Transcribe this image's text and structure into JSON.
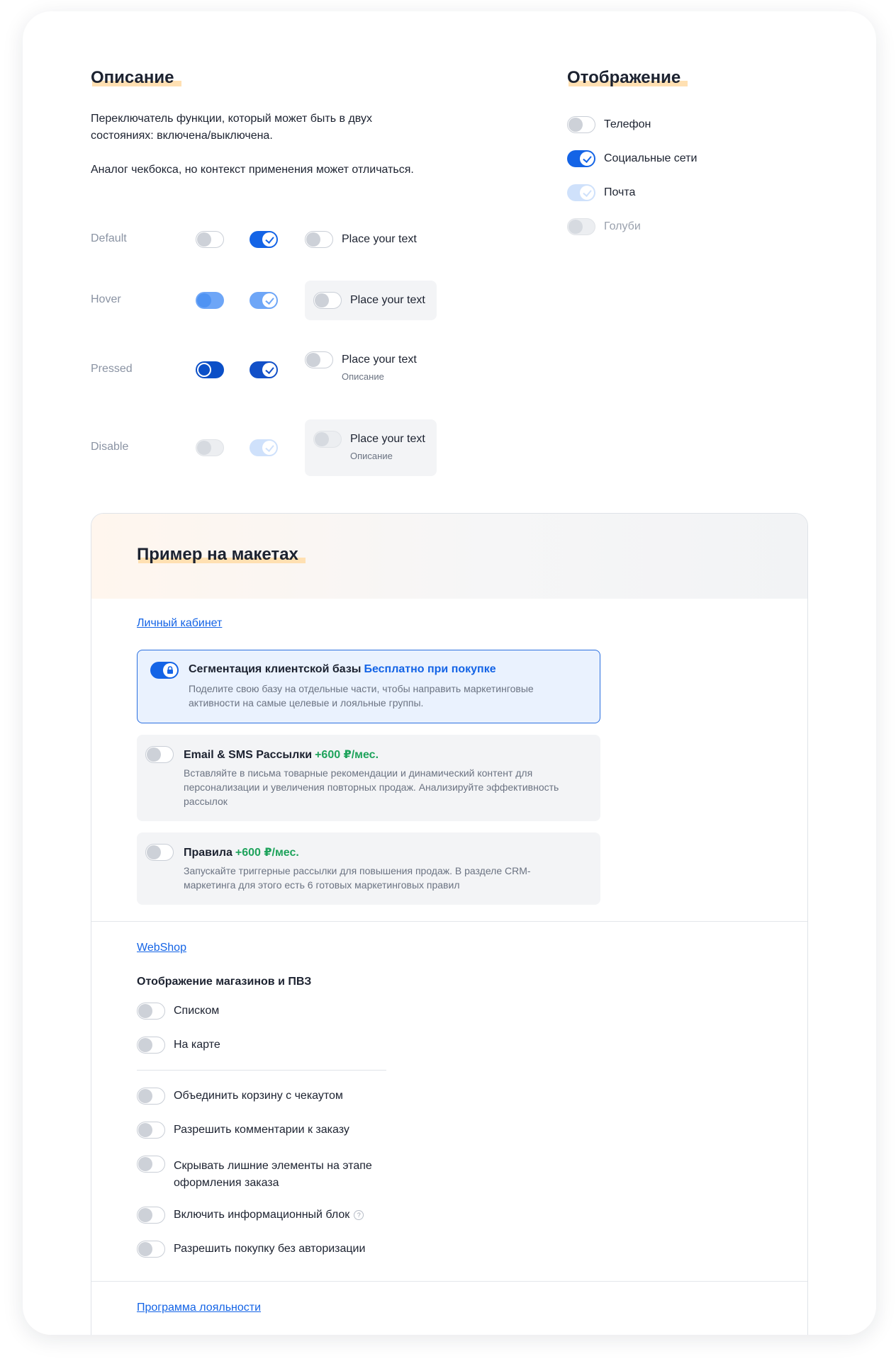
{
  "description": {
    "title": "Описание",
    "para1": "Переключатель функции, который может быть в двух состояниях: включена/выключена.",
    "para2": "Аналог чекбокса, но контекст применения может отличаться."
  },
  "display": {
    "title": "Отображение",
    "items": [
      {
        "label": "Телефон",
        "checked": false
      },
      {
        "label": "Социальные сети",
        "checked": true
      },
      {
        "label": "Почта",
        "checked": true,
        "disabled": true
      },
      {
        "label": "Голуби",
        "checked": false,
        "disabled": true
      }
    ]
  },
  "states": {
    "default": "Default",
    "hover": "Hover",
    "pressed": "Pressed",
    "disable": "Disable",
    "placeholder": "Place your text",
    "caption": "Описание"
  },
  "example": {
    "title": "Пример на макетах",
    "account_link": "Личный кабинет",
    "features": [
      {
        "title": "Сегментация клиентской базы",
        "accent": "Бесплатно при покупке",
        "desc": "Поделите свою базу на отдельные части, чтобы направить маркетинговые активности на самые целевые и лояльные группы.",
        "on": true
      },
      {
        "title": "Email & SMS Рассылки",
        "accent": "+600 ₽/мес.",
        "desc": "Вставляйте в письма товарные рекомендации и динамический контент для персонализации и увеличения повторных продаж. Анализируйте эффективность рассылок",
        "on": false
      },
      {
        "title": "Правила",
        "accent": "+600 ₽/мес.",
        "desc": "Запускайте триггерные рассылки для повышения продаж. В разделе CRM-маркетинга для этого есть 6 готовых маркетинговых правил",
        "on": false
      }
    ],
    "webshop_link": "WebShop",
    "webshop_heading": "Отображение магазинов и ПВЗ",
    "webshop_group1": [
      "Списком",
      "На карте"
    ],
    "webshop_group2": [
      "Объединить корзину с чекаутом",
      "Разрешить комментарии к заказу",
      "Скрывать лишние элементы на этапе оформления заказа",
      "Включить информационный блок",
      "Разрешить покупку без авторизации"
    ],
    "loyalty_link": "Программа лояльности"
  },
  "colors": {
    "accent_blue": "#1464e6",
    "price_green": "#1fa35c",
    "highlight": "#ffe0b2"
  }
}
